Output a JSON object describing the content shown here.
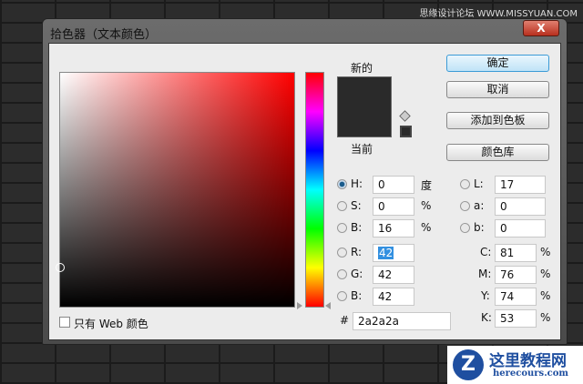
{
  "watermark": "思缘设计论坛 WWW.MISSYUAN.COM",
  "dialog": {
    "title": "拾色器（文本颜色）",
    "close": "X"
  },
  "labels": {
    "new": "新的",
    "current": "当前",
    "web_only": "只有 Web 颜色"
  },
  "buttons": {
    "ok": "确定",
    "cancel": "取消",
    "add_swatch": "添加到色板",
    "color_libraries": "颜色库"
  },
  "fields": {
    "H": {
      "label": "H:",
      "value": "0",
      "unit": "度"
    },
    "S": {
      "label": "S:",
      "value": "0",
      "unit": "%"
    },
    "Bv": {
      "label": "B:",
      "value": "16",
      "unit": "%"
    },
    "R": {
      "label": "R:",
      "value": "42"
    },
    "G": {
      "label": "G:",
      "value": "42"
    },
    "B": {
      "label": "B:",
      "value": "42"
    },
    "L": {
      "label": "L:",
      "value": "17"
    },
    "a": {
      "label": "a:",
      "value": "0"
    },
    "b": {
      "label": "b:",
      "value": "0"
    },
    "C": {
      "label": "C:",
      "value": "81",
      "unit": "%"
    },
    "M": {
      "label": "M:",
      "value": "76",
      "unit": "%"
    },
    "Y": {
      "label": "Y:",
      "value": "74",
      "unit": "%"
    },
    "K": {
      "label": "K:",
      "value": "53",
      "unit": "%"
    },
    "hex": {
      "label": "#",
      "value": "2a2a2a"
    }
  },
  "colors": {
    "current": "#2a2a2a"
  },
  "logo": {
    "name": "这里教程网",
    "url": "herecours.com"
  }
}
